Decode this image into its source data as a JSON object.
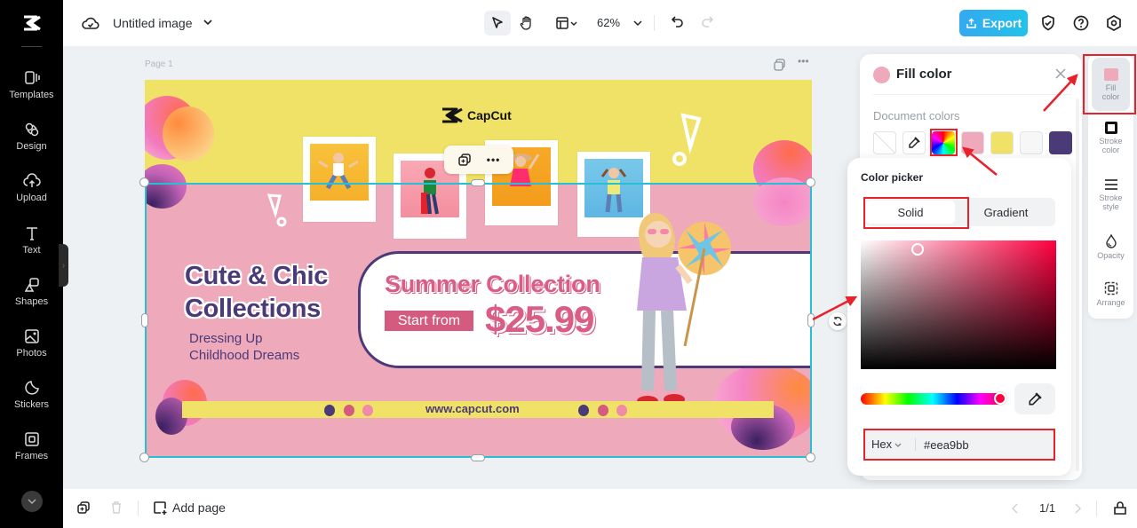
{
  "app": {
    "logo_icon": "capcut-logo-icon",
    "document_title": "Untitled image"
  },
  "toolbar": {
    "tools": [
      {
        "name": "select",
        "icon": "pointer-icon",
        "active": true
      },
      {
        "name": "hand",
        "icon": "hand-icon",
        "active": false
      },
      {
        "name": "layout",
        "icon": "layout-icon",
        "active": false
      }
    ],
    "zoom": "62%",
    "undo_icon": "undo-icon",
    "redo_icon": "redo-icon",
    "export_label": "Export",
    "right_icons": [
      "shield-check-icon",
      "help-icon",
      "settings-icon"
    ]
  },
  "sidebar": {
    "items": [
      {
        "label": "Templates",
        "icon": "templates-icon"
      },
      {
        "label": "Design",
        "icon": "design-icon"
      },
      {
        "label": "Upload",
        "icon": "upload-icon"
      },
      {
        "label": "Text",
        "icon": "text-icon"
      },
      {
        "label": "Shapes",
        "icon": "shapes-icon"
      },
      {
        "label": "Photos",
        "icon": "photos-icon"
      },
      {
        "label": "Stickers",
        "icon": "stickers-icon"
      },
      {
        "label": "Frames",
        "icon": "frames-icon"
      }
    ]
  },
  "canvas": {
    "page_label": "Page 1",
    "design": {
      "brand": "CapCut",
      "headline_line1": "Cute & Chic",
      "headline_line2": "Collections",
      "sub_line1": "Dressing Up",
      "sub_line2": "Childhood Dreams",
      "promo_title": "Summer Collection",
      "start_from": "Start from",
      "price": "$25.99",
      "url": "www.capcut.com",
      "colors": {
        "yellow": "#f0e266",
        "pink": "#eea9bb",
        "purple": "#4b3a78",
        "rose": "#d45a80"
      }
    }
  },
  "bottombar": {
    "add_page_label": "Add page",
    "page_count": "1/1"
  },
  "fill_panel": {
    "title": "Fill color",
    "current_color": "#eea9bb",
    "document_colors_label": "Document colors",
    "swatches": [
      {
        "type": "none"
      },
      {
        "type": "eyedropper"
      },
      {
        "type": "rainbow"
      },
      {
        "type": "color",
        "hex": "#eea9bb"
      },
      {
        "type": "color",
        "hex": "#f0e266"
      },
      {
        "type": "color",
        "hex": "#f7f7f8"
      },
      {
        "type": "color",
        "hex": "#4b3a78"
      }
    ]
  },
  "color_picker": {
    "title": "Color picker",
    "tabs": [
      "Solid",
      "Gradient"
    ],
    "active_tab": "Solid",
    "hex_mode": "Hex",
    "hex_value": "#eea9bb",
    "hue_color": "#ff0040"
  },
  "properties": {
    "items": [
      {
        "label_l1": "Fill",
        "label_l2": "color",
        "icon": "fill-color-icon",
        "active": true
      },
      {
        "label_l1": "Stroke",
        "label_l2": "color",
        "icon": "stroke-color-icon"
      },
      {
        "label_l1": "Stroke",
        "label_l2": "style",
        "icon": "stroke-style-icon"
      },
      {
        "label_l1": "Opacity",
        "label_l2": "",
        "icon": "opacity-icon"
      },
      {
        "label_l1": "Arrange",
        "label_l2": "",
        "icon": "arrange-icon"
      }
    ]
  }
}
